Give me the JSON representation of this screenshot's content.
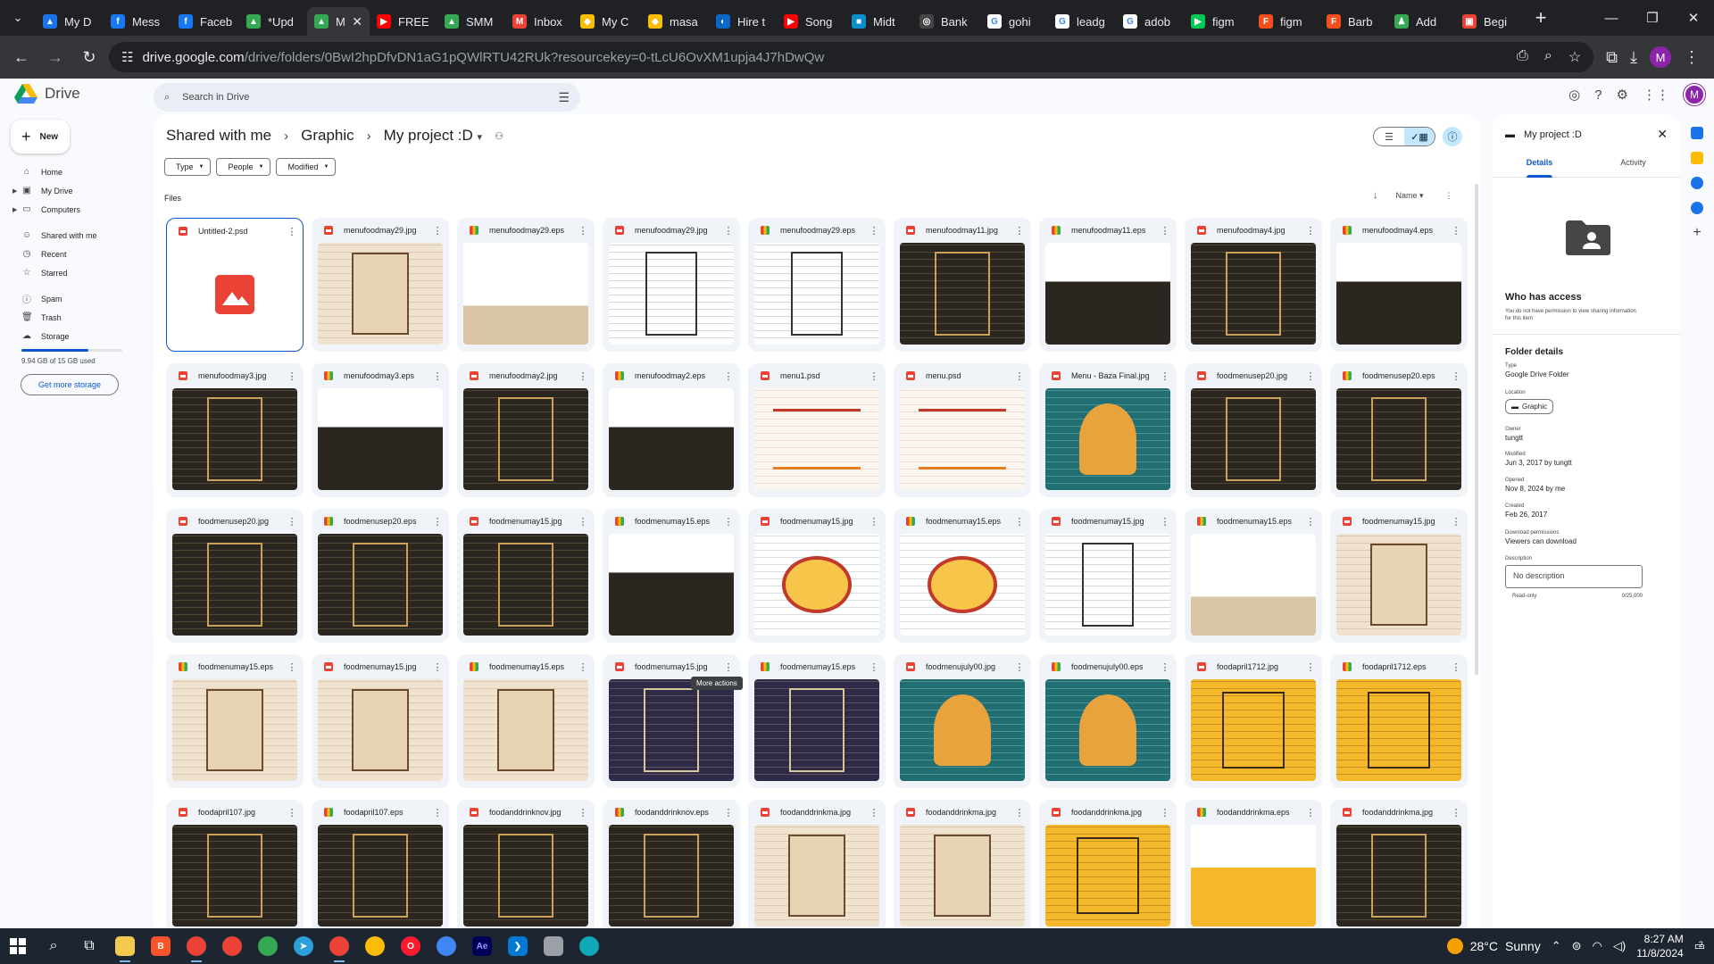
{
  "browser": {
    "tabs": [
      {
        "title": "My D",
        "color": "#1a73e8",
        "glyph": "▲"
      },
      {
        "title": "Mess",
        "color": "#1877f2",
        "glyph": "f"
      },
      {
        "title": "Faceb",
        "color": "#1877f2",
        "glyph": "f"
      },
      {
        "title": "*Upd",
        "color": "#34a853",
        "glyph": "▲"
      },
      {
        "title": "M",
        "color": "#34a853",
        "glyph": "▲",
        "active": true
      },
      {
        "title": "FREE",
        "color": "#ff0000",
        "glyph": "▶"
      },
      {
        "title": "SMM",
        "color": "#34a853",
        "glyph": "▲"
      },
      {
        "title": "Inbox",
        "color": "#ea4335",
        "glyph": "M"
      },
      {
        "title": "My C",
        "color": "#fbbc04",
        "glyph": "◆"
      },
      {
        "title": "masa",
        "color": "#fbbc04",
        "glyph": "◆"
      },
      {
        "title": "Hire t",
        "color": "#0a66c2",
        "glyph": "◐"
      },
      {
        "title": "Song",
        "color": "#ff0000",
        "glyph": "▶"
      },
      {
        "title": "Midt",
        "color": "#0b8ec9",
        "glyph": "■"
      },
      {
        "title": "Bank",
        "color": "#444444",
        "glyph": "◎"
      },
      {
        "title": "gohi",
        "color": "#ffffff",
        "glyph": "G"
      },
      {
        "title": "leadg",
        "color": "#ffffff",
        "glyph": "G"
      },
      {
        "title": "adob",
        "color": "#ffffff",
        "glyph": "G"
      },
      {
        "title": "figm",
        "color": "#00c853",
        "glyph": "▶"
      },
      {
        "title": "figm",
        "color": "#f24e1e",
        "glyph": "F"
      },
      {
        "title": "Barb",
        "color": "#f24e1e",
        "glyph": "F"
      },
      {
        "title": "Add",
        "color": "#34a853",
        "glyph": "♟"
      },
      {
        "title": "Begi",
        "color": "#ea4335",
        "glyph": "▣"
      }
    ],
    "url_host": "drive.google.com",
    "url_path": "/drive/folders/0BwI2hpDfvDN1aG1pQWlRTU42RUk?resourcekey=0-tLcU6OvXM1upja4J7hDwQw",
    "profile_initial": "M"
  },
  "drive": {
    "app_name": "Drive",
    "search_placeholder": "Search in Drive",
    "avatar_initial": "M",
    "new_label": "New",
    "nav": [
      {
        "label": "Home",
        "icon": "⌂",
        "caret": false
      },
      {
        "label": "My Drive",
        "icon": "▣",
        "caret": true
      },
      {
        "label": "Computers",
        "icon": "▭",
        "caret": true
      },
      {
        "gap": true
      },
      {
        "label": "Shared with me",
        "icon": "☺",
        "caret": false
      },
      {
        "label": "Recent",
        "icon": "◷",
        "caret": false
      },
      {
        "label": "Starred",
        "icon": "☆",
        "caret": false
      },
      {
        "gap": true
      },
      {
        "label": "Spam",
        "icon": "ⓘ",
        "caret": false
      },
      {
        "label": "Trash",
        "icon": "🗑",
        "caret": false
      },
      {
        "label": "Storage",
        "icon": "☁",
        "caret": false
      }
    ],
    "storage_used_fraction": 0.66,
    "storage_text": "9.94 GB of 15 GB used",
    "get_storage_label": "Get more storage",
    "breadcrumb": [
      "Shared with me",
      "Graphic",
      "My project :D"
    ],
    "filters": [
      "Type",
      "People",
      "Modified"
    ],
    "files_heading": "Files",
    "sort_label": "Name",
    "tooltip": "More actions",
    "files": [
      {
        "name": "Untitled-2.psd",
        "kind": "img",
        "thumb": "placeholder",
        "selected": true
      },
      {
        "name": "menufoodmay29.jpg",
        "kind": "img",
        "thumb": "cream"
      },
      {
        "name": "menufoodmay29.eps",
        "kind": "psd",
        "thumb": "blank-brown"
      },
      {
        "name": "menufoodmay29.jpg",
        "kind": "img",
        "thumb": "whiteb"
      },
      {
        "name": "menufoodmay29.eps",
        "kind": "psd",
        "thumb": "whiteb"
      },
      {
        "name": "menufoodmay11.jpg",
        "kind": "img",
        "thumb": "dark"
      },
      {
        "name": "menufoodmay11.eps",
        "kind": "psd",
        "thumb": "blank-dark"
      },
      {
        "name": "menufoodmay4.jpg",
        "kind": "img",
        "thumb": "dark"
      },
      {
        "name": "menufoodmay4.eps",
        "kind": "psd",
        "thumb": "blank-dark"
      },
      {
        "name": "menufoodmay3.jpg",
        "kind": "img",
        "thumb": "dark"
      },
      {
        "name": "menufoodmay3.eps",
        "kind": "psd",
        "thumb": "blank-dark"
      },
      {
        "name": "menufoodmay2.jpg",
        "kind": "img",
        "thumb": "dark"
      },
      {
        "name": "menufoodmay2.eps",
        "kind": "psd",
        "thumb": "blank-dark"
      },
      {
        "name": "menu1.psd",
        "kind": "img",
        "thumb": "white"
      },
      {
        "name": "menu.psd",
        "kind": "img",
        "thumb": "white"
      },
      {
        "name": "Menu - Baza Final.jpg",
        "kind": "img",
        "thumb": "teal"
      },
      {
        "name": "foodmenusep20.jpg",
        "kind": "img",
        "thumb": "dark"
      },
      {
        "name": "foodmenusep20.eps",
        "kind": "psd",
        "thumb": "dark"
      },
      {
        "name": "foodmenusep20.jpg",
        "kind": "img",
        "thumb": "dark"
      },
      {
        "name": "foodmenusep20.eps",
        "kind": "psd",
        "thumb": "dark"
      },
      {
        "name": "foodmenumay15.jpg",
        "kind": "img",
        "thumb": "dark"
      },
      {
        "name": "foodmenumay15.eps",
        "kind": "psd",
        "thumb": "blank-dark"
      },
      {
        "name": "foodmenumay15.jpg",
        "kind": "img",
        "thumb": "tealwhite"
      },
      {
        "name": "foodmenumay15.eps",
        "kind": "psd",
        "thumb": "tealwhite"
      },
      {
        "name": "foodmenumay15.jpg",
        "kind": "img",
        "thumb": "whiteb"
      },
      {
        "name": "foodmenumay15.eps",
        "kind": "psd",
        "thumb": "blank-brown"
      },
      {
        "name": "foodmenumay15.jpg",
        "kind": "img",
        "thumb": "cream"
      },
      {
        "name": "foodmenumay15.eps",
        "kind": "psd",
        "thumb": "cream"
      },
      {
        "name": "foodmenumay15.jpg",
        "kind": "img",
        "thumb": "cream"
      },
      {
        "name": "foodmenumay15.eps",
        "kind": "psd",
        "thumb": "cream"
      },
      {
        "name": "foodmenumay15.jpg",
        "kind": "img",
        "thumb": "navy"
      },
      {
        "name": "foodmenumay15.eps",
        "kind": "psd",
        "thumb": "navy"
      },
      {
        "name": "foodmenujuly00.jpg",
        "kind": "img",
        "thumb": "teal"
      },
      {
        "name": "foodmenujuly00.eps",
        "kind": "psd",
        "thumb": "teal"
      },
      {
        "name": "foodapril1712.jpg",
        "kind": "img",
        "thumb": "yellow"
      },
      {
        "name": "foodapril1712.eps",
        "kind": "psd",
        "thumb": "yellow"
      },
      {
        "name": "foodapril107.jpg",
        "kind": "img",
        "thumb": "dark"
      },
      {
        "name": "foodapril107.eps",
        "kind": "psd",
        "thumb": "dark"
      },
      {
        "name": "foodanddrinknov.jpg",
        "kind": "img",
        "thumb": "dark"
      },
      {
        "name": "foodanddrinknov.eps",
        "kind": "psd",
        "thumb": "dark"
      },
      {
        "name": "foodanddrinkma.jpg",
        "kind": "img",
        "thumb": "cream"
      },
      {
        "name": "foodanddrinkma.jpg",
        "kind": "img",
        "thumb": "cream"
      },
      {
        "name": "foodanddrinkma.jpg",
        "kind": "img",
        "thumb": "yellow"
      },
      {
        "name": "foodanddrinkma.eps",
        "kind": "psd",
        "thumb": "blank-yellow"
      },
      {
        "name": "foodanddrinkma.jpg",
        "kind": "img",
        "thumb": "dark"
      }
    ],
    "details": {
      "title": "My project :D",
      "tabs": [
        "Details",
        "Activity"
      ],
      "who_has_access": "Who has access",
      "access_note": "You do not have permission to view sharing information for this item",
      "folder_details": "Folder details",
      "props": [
        {
          "k": "Type",
          "v": "Google Drive Folder"
        },
        {
          "k": "Location",
          "v": "Graphic",
          "chip": true
        },
        {
          "k": "Owner",
          "v": "tungtt"
        },
        {
          "k": "Modified",
          "v": "Jun 3, 2017 by tungtt"
        },
        {
          "k": "Opened",
          "v": "Nov 8, 2024 by me"
        },
        {
          "k": "Created",
          "v": "Feb 26, 2017"
        },
        {
          "k": "Download permissions",
          "v": "Viewers can download"
        },
        {
          "k": "Description",
          "v": ""
        }
      ],
      "description_placeholder": "No description",
      "readonly": "Read-only",
      "char_count": "0/25,000"
    }
  },
  "taskbar": {
    "weather_temp": "28°C",
    "weather_cond": "Sunny",
    "time": "8:27 AM",
    "date": "11/8/2024",
    "notif_count": "2"
  }
}
